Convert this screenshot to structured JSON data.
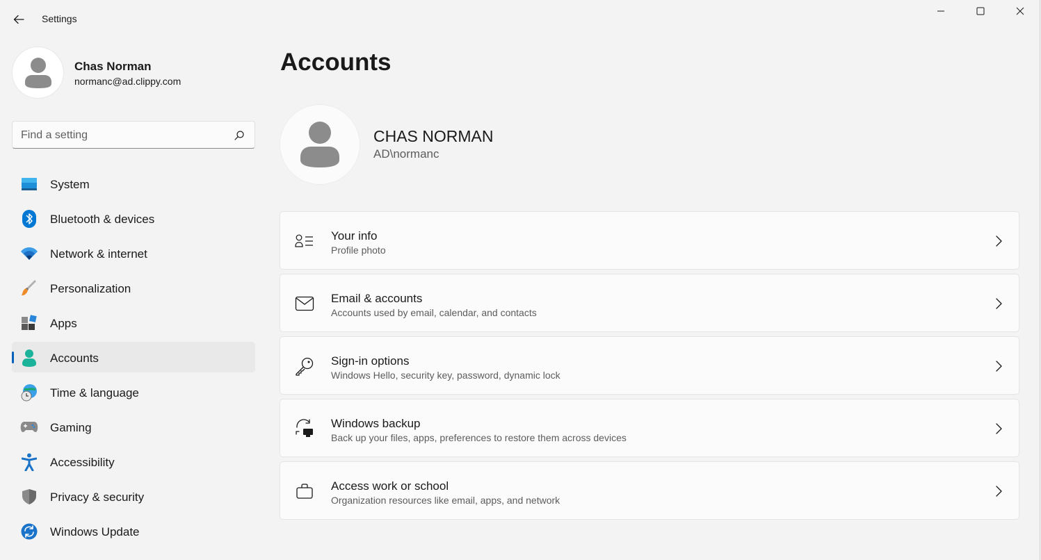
{
  "window": {
    "title": "Settings",
    "controls": [
      "minimize-icon",
      "maximize-icon",
      "close-icon"
    ]
  },
  "profile": {
    "name": "Chas Norman",
    "email": "normanc@ad.clippy.com"
  },
  "search": {
    "placeholder": "Find a setting"
  },
  "sidebar": {
    "items": [
      {
        "label": "System",
        "icon": "system-icon"
      },
      {
        "label": "Bluetooth & devices",
        "icon": "bluetooth-icon"
      },
      {
        "label": "Network & internet",
        "icon": "wifi-icon"
      },
      {
        "label": "Personalization",
        "icon": "paintbrush-icon"
      },
      {
        "label": "Apps",
        "icon": "apps-icon"
      },
      {
        "label": "Accounts",
        "icon": "accounts-icon",
        "active": true
      },
      {
        "label": "Time & language",
        "icon": "globe-clock-icon"
      },
      {
        "label": "Gaming",
        "icon": "gamepad-icon"
      },
      {
        "label": "Accessibility",
        "icon": "accessibility-icon"
      },
      {
        "label": "Privacy & security",
        "icon": "shield-icon"
      },
      {
        "label": "Windows Update",
        "icon": "update-icon"
      }
    ]
  },
  "main": {
    "title": "Accounts",
    "user": {
      "display_name": "CHAS NORMAN",
      "account": "AD\\normanc"
    },
    "cards": [
      {
        "title": "Your info",
        "description": "Profile photo",
        "icon": "person-details-icon"
      },
      {
        "title": "Email & accounts",
        "description": "Accounts used by email, calendar, and contacts",
        "icon": "mail-icon"
      },
      {
        "title": "Sign-in options",
        "description": "Windows Hello, security key, password, dynamic lock",
        "icon": "key-icon"
      },
      {
        "title": "Windows backup",
        "description": "Back up your files, apps, preferences to restore them across devices",
        "icon": "backup-icon"
      },
      {
        "title": "Access work or school",
        "description": "Organization resources like email, apps, and network",
        "icon": "briefcase-icon"
      }
    ]
  },
  "colors": {
    "accent": "#005fb8",
    "background": "#f3f3f3",
    "card": "#fbfbfb",
    "active_item": "#e9e9e9"
  }
}
